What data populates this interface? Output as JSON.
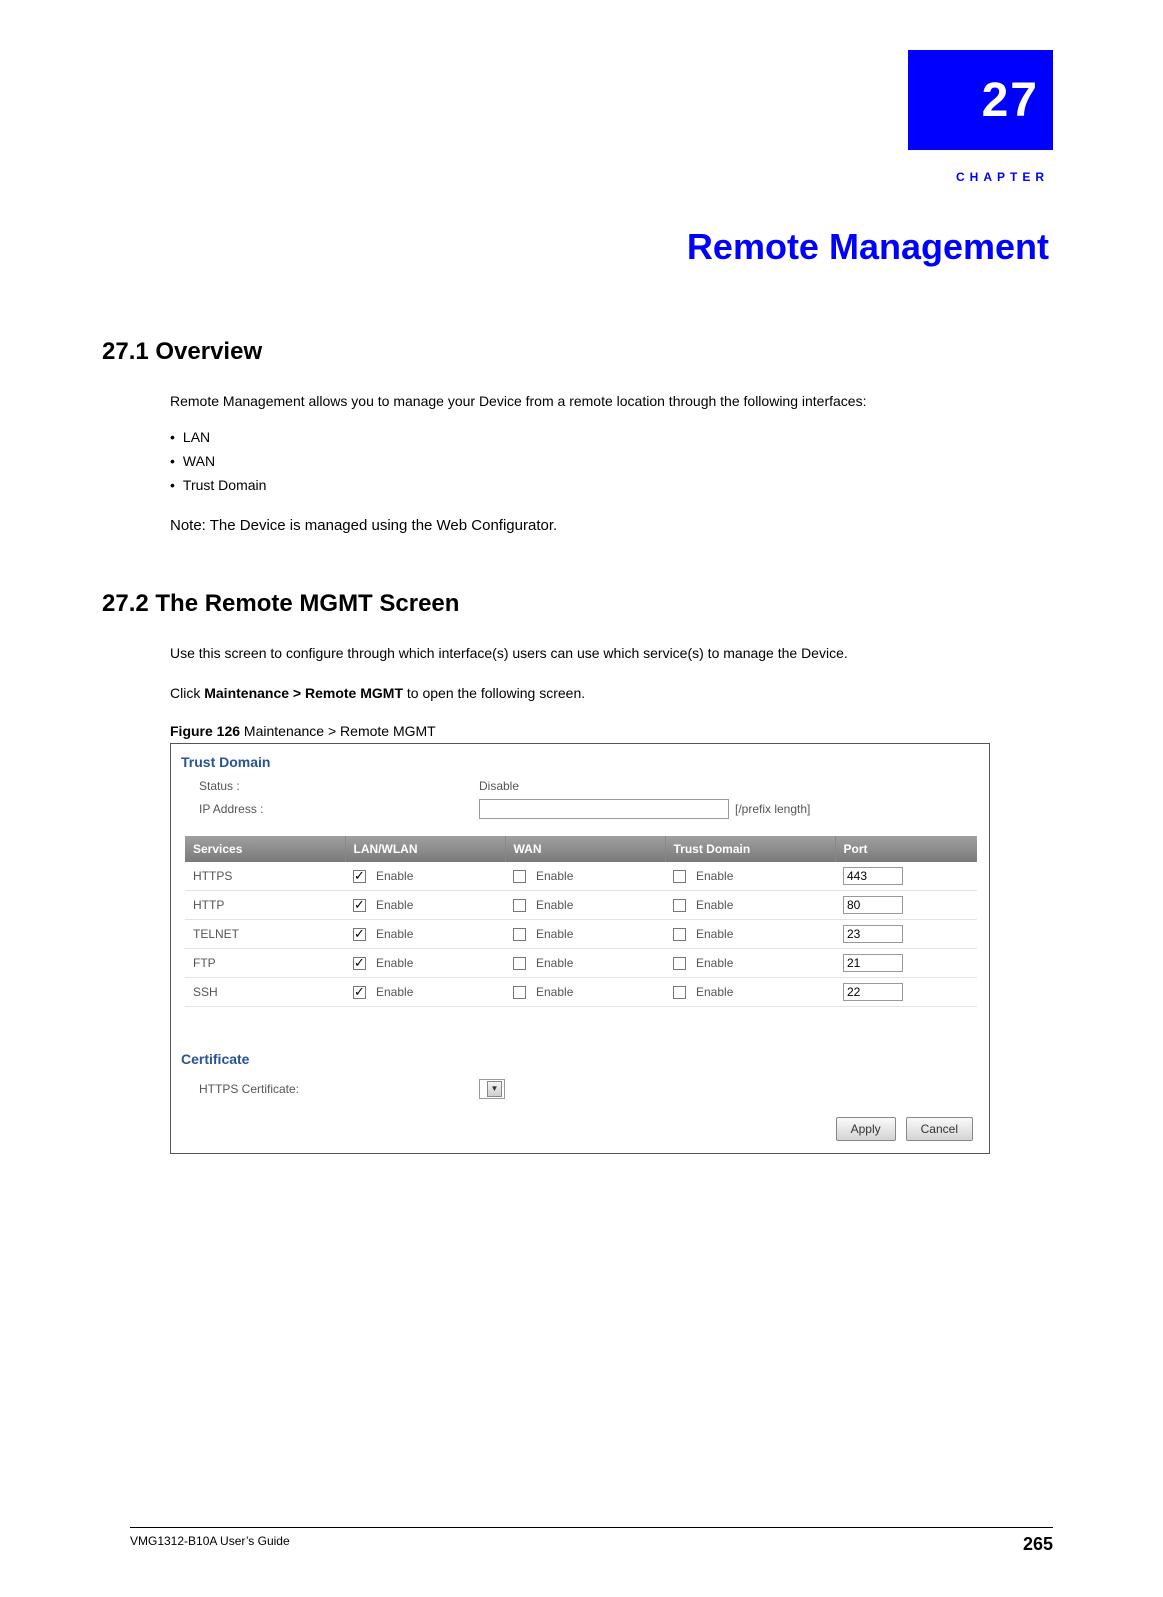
{
  "chapter": {
    "number": "27",
    "prefix": "CHAPTER",
    "title": "Remote Management"
  },
  "section1": {
    "heading": "27.1  Overview",
    "intro": "Remote Management allows you to manage your Device from a remote location through the following interfaces:",
    "bullets": [
      "LAN",
      "WAN",
      "Trust Domain"
    ],
    "note": "Note: The Device is managed using the Web Configurator."
  },
  "section2": {
    "heading": "27.2  The Remote MGMT Screen",
    "intro": "Use this screen to configure through which interface(s) users can use which service(s) to manage the Device.",
    "click_prefix": "Click ",
    "click_bold": "Maintenance > Remote MGMT",
    "click_suffix": " to open the following screen.",
    "figure_label": "Figure 126",
    "figure_caption": "   Maintenance > Remote MGMT"
  },
  "screenshot": {
    "trust_domain_title": "Trust Domain",
    "status_label": "Status :",
    "status_value": "Disable",
    "ip_label": "IP Address :",
    "ip_value": "",
    "ip_suffix": "[/prefix length]",
    "table": {
      "headers": [
        "Services",
        "LAN/WLAN",
        "WAN",
        "Trust Domain",
        "Port"
      ],
      "enable_label": "Enable",
      "rows": [
        {
          "service": "HTTPS",
          "lan": true,
          "wan": false,
          "td": false,
          "port": "443"
        },
        {
          "service": "HTTP",
          "lan": true,
          "wan": false,
          "td": false,
          "port": "80"
        },
        {
          "service": "TELNET",
          "lan": true,
          "wan": false,
          "td": false,
          "port": "23"
        },
        {
          "service": "FTP",
          "lan": true,
          "wan": false,
          "td": false,
          "port": "21"
        },
        {
          "service": "SSH",
          "lan": true,
          "wan": false,
          "td": false,
          "port": "22"
        }
      ]
    },
    "certificate_title": "Certificate",
    "certificate_label": "HTTPS Certificate:",
    "apply": "Apply",
    "cancel": "Cancel"
  },
  "footer": {
    "left": "VMG1312-B10A User’s Guide",
    "right": "265"
  }
}
